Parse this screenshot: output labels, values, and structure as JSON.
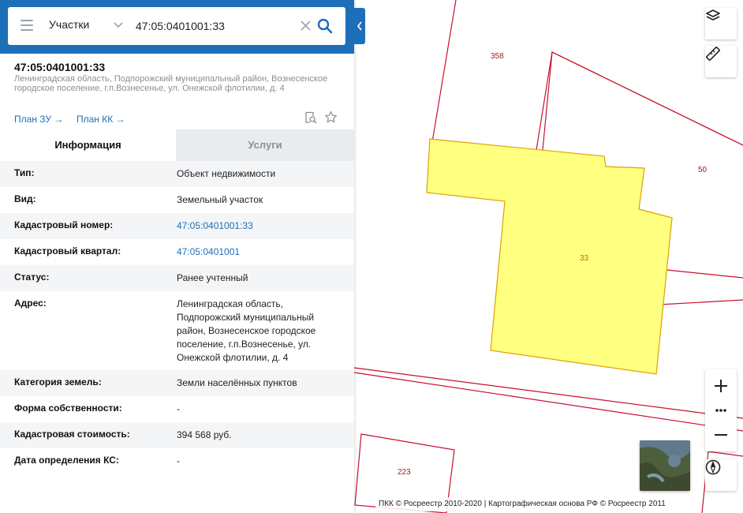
{
  "search": {
    "layer": "Участки",
    "value": "47:05:0401001:33"
  },
  "object": {
    "title": "47:05:0401001:33",
    "address": "Ленинградская область, Подпорожский муниципальный район, Вознесенское городское поселение, г.п.Вознесенье, ул. Онежской флотилии, д. 4"
  },
  "links": {
    "plan_zu": "План ЗУ",
    "plan_kk": "План КК"
  },
  "tabs": {
    "info": "Информация",
    "services": "Услуги"
  },
  "attributes": [
    {
      "key": "Тип:",
      "value": "Объект недвижимости"
    },
    {
      "key": "Вид:",
      "value": "Земельный участок"
    },
    {
      "key": "Кадастровый номер:",
      "value": "47:05:0401001:33"
    },
    {
      "key": "Кадастровый квартал:",
      "value": "47:05:0401001"
    },
    {
      "key": "Статус:",
      "value": "Ранее учтенный"
    },
    {
      "key": "Адрес:",
      "value": "Ленинградская область, Подпорожский муниципальный район, Вознесенское городское поселение, г.п.Вознесенье, ул. Онежской флотилии, д. 4"
    },
    {
      "key": "Категория земель:",
      "value": "Земли населённых пунктов"
    },
    {
      "key": "Форма собственности:",
      "value": "-"
    },
    {
      "key": "Кадастровая стоимость:",
      "value": "394 568 руб."
    },
    {
      "key": "Дата определения КС:",
      "value": "-"
    }
  ],
  "map": {
    "parcels": {
      "p358": "358",
      "p50": "50",
      "p33": "33",
      "p223": "223"
    },
    "attribution": "ПКК © Росреестр 2010-2020 | Картографическая основа РФ © Росреестр 2011",
    "colors": {
      "parcel_border": "#c8102e",
      "selected_fill": "#ffff80",
      "selected_border": "#e0a000",
      "accent": "#1d6fb8"
    }
  }
}
